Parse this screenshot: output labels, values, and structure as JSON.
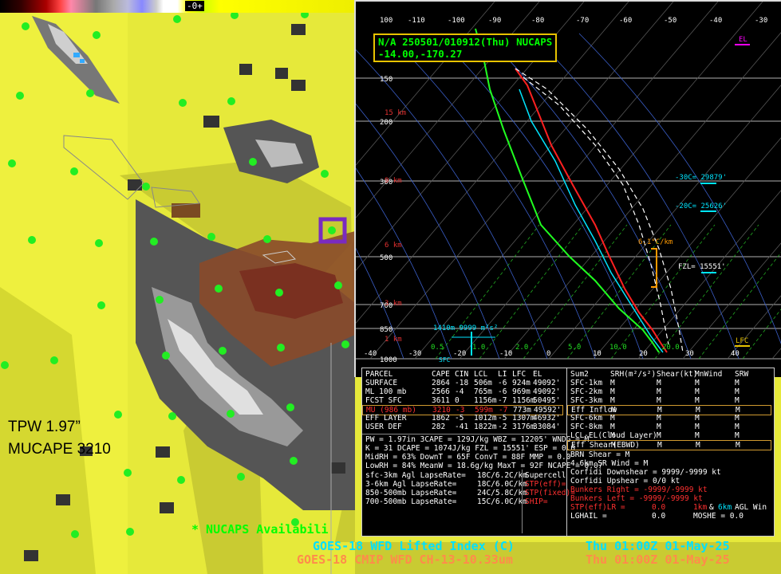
{
  "colorbar": {
    "zero_label": "-0+"
  },
  "map": {
    "label_tpw": "TPW 1.97”",
    "label_mucape": "MUCAPE  3210",
    "availability": "* NUCAPS Availabili",
    "caption_li": {
      "product": "GOES-18 WFD Lifted Index (C)",
      "time": "Thu 01:00Z 01-May-25"
    },
    "caption_ch": {
      "product": "GOES-18 CMIP WFD CH-13-10.33um",
      "time": "Thu 01:00Z 01-May-25"
    }
  },
  "skewt": {
    "title_line1": "N/A 250501/010912(Thu) NUCAPS",
    "title_line2": "-14.00,-170.27",
    "top_temps": [
      "100",
      "-110",
      "-100",
      "-90",
      "-80",
      "-70",
      "-60",
      "-50",
      "-40",
      "-30"
    ],
    "bottom_temps": [
      "-40",
      "-30",
      "-20",
      "-10",
      "0",
      "10",
      "20",
      "30",
      "40"
    ],
    "pressure_labels": [
      "150",
      "200",
      "300",
      "500",
      "700",
      "850",
      "1000"
    ],
    "height_labels": [
      "15 km",
      "9 km",
      "6 km",
      "3 km",
      "1 km"
    ],
    "wetbulb_labels": [
      "0.5",
      "1.0",
      "2.0",
      "5.0",
      "10.0",
      "20.0"
    ],
    "el_label": "EL",
    "lfc_label": "LFC",
    "lapse_label": "6.1°C/km",
    "fzl_label": "FZL= 15551'",
    "m30_label": "-30C= 29879'",
    "m20_label": "-20C= 25626'",
    "helicity_label": "1410m 9999 m²s²",
    "sfc_label": "SFC"
  },
  "parcel_table": {
    "headers": [
      "PARCEL",
      "CAPE",
      "CIN",
      "LCL",
      "LI",
      "LFC",
      "EL"
    ],
    "rows": [
      [
        "SURFACE",
        "2864",
        "-18",
        "506m",
        "-6",
        "924m",
        "49092'"
      ],
      [
        "ML 100 mb",
        "2566",
        "-4",
        "765m",
        "-6",
        "969m",
        "49092'"
      ],
      [
        "FCST SFC",
        "3611",
        "0",
        "1156m",
        "-7",
        "1156m",
        "50495'"
      ],
      [
        "MU (986 mb)",
        "3210",
        "-3",
        "599m",
        "-7",
        "773m",
        "49592'"
      ],
      [
        "EFF LAYER",
        "1862",
        "-5",
        "1012m",
        "-5",
        "1307m",
        "46932'"
      ],
      [
        "USER DEF",
        "282",
        "-41",
        "1822m",
        "-2",
        "3176m",
        "33084'"
      ]
    ],
    "extra": [
      "PW = 1.97in  3CAPE = 129J/kg  WBZ = 12205'  WNDG = M",
      "K = 31    DCAPE = 1074J/kg  FZL = 15551'  ESP = 0.0",
      "MidRH = 63%  DownT = 65F  ConvT = 88F  MMP = 0.0",
      "LowRH = 84%  MeanW = 18.6g/kg  MaxT = 92F  NCAPE = 0.07"
    ],
    "lapse": [
      [
        "sfc-3km Agl LapseRate=",
        "18C/6.2C/km"
      ],
      [
        "3-6km Agl LapseRate=",
        "18C/6.0C/km"
      ],
      [
        "850-500mb LapseRate=",
        "24C/5.8C/km"
      ],
      [
        "700-500mb LapseRate=",
        "15C/6.0C/km"
      ]
    ],
    "indices": [
      "Supercell",
      "STP(eff)=",
      "STP(fixed)=",
      "SHIP="
    ]
  },
  "summary_table": {
    "headers": [
      "Sum2",
      "SRH(m²/s²)",
      "Shear(kt)",
      "MnWind",
      "SRW"
    ],
    "rows": [
      [
        "SFC-1km",
        "M",
        "M",
        "M",
        "M"
      ],
      [
        "SFC-2km",
        "M",
        "M",
        "M",
        "M"
      ],
      [
        "SFC-3km",
        "M",
        "M",
        "M",
        "M"
      ],
      [
        "Eff Inflow",
        "M",
        "M",
        "M",
        "M"
      ],
      [
        "SFC-6km",
        "M",
        "M",
        "M",
        "M"
      ],
      [
        "SFC-8km",
        "M",
        "M",
        "M",
        "M"
      ],
      [
        "LCL-EL(Cloud Layer)",
        "M",
        "M",
        "M",
        "M"
      ],
      [
        "Eff Shear(EBWD)",
        "M",
        "M",
        "M",
        "M"
      ]
    ],
    "brn": "BRN Shear =          M",
    "sr_wind": "4-6km SR Wind =   M",
    "corfidi_down": "Corfidi Downshear = 9999/-9999 kt",
    "corfidi_up": "Corfidi Upshear = 0/0 kt",
    "bunkers_right": "Bunkers Right =   -9999/-9999 kt",
    "bunkers_left": "Bunkers Left =    -9999/-9999 kt",
    "stp_label": "STP(eff)LR =",
    "stp_value": "0.0",
    "stp_1km": "1km",
    "stp_amp": "&",
    "stp_6km": "6km",
    "stp_agl": "AGL Win",
    "lghail": "LGHAIL =",
    "lghail_value": "0.0",
    "moshe": "MOSHE = 0.0"
  },
  "colors": {
    "temperature": "#ff2020",
    "dewpoint": "#20ff20",
    "wetbulb": "#00e5ff",
    "highlight": "#d09a30",
    "caption_li": "#00e0ff",
    "caption_ch": "#ff8c4a",
    "nucaps_dots": "#22ee22"
  }
}
